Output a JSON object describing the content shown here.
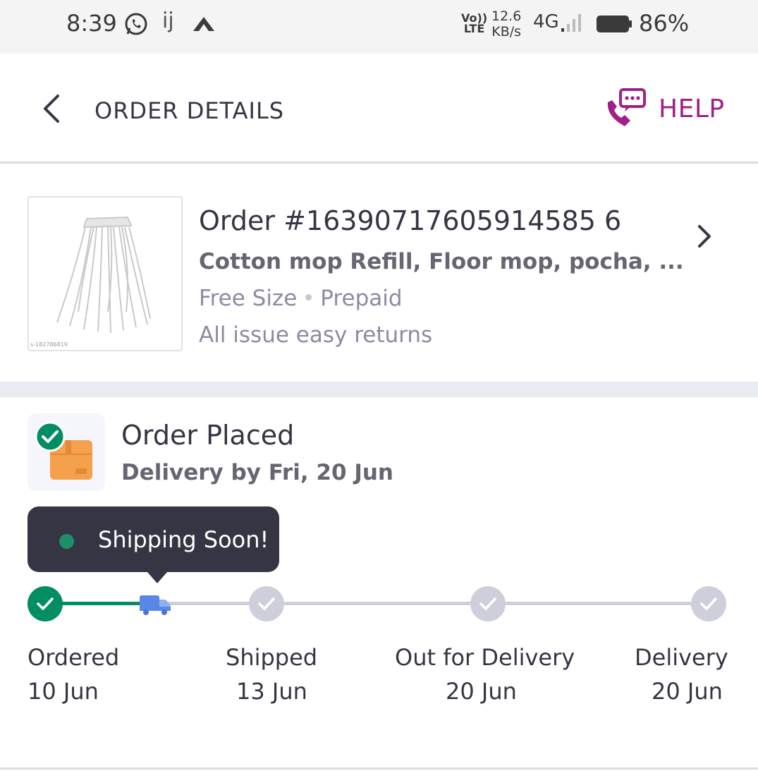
{
  "status_bar": {
    "time": "8:39",
    "app_icons": [
      "whatsapp-icon",
      "yj-icon",
      "arrow-icon"
    ],
    "yj_text": "ij",
    "volte_line1": "Vo))",
    "volte_line2": "LTE",
    "speed_value": "12.6",
    "speed_unit": "KB/s",
    "network": "4G",
    "battery": "86%"
  },
  "header": {
    "title": "ORDER DETAILS",
    "help_label": "HELP",
    "accent_color": "#9f2089"
  },
  "order": {
    "order_number": "Order #16390717605914585 6",
    "product_name": "Cotton mop Refill, Floor mop, pocha, ...",
    "size": "Free Size",
    "payment": "Prepaid",
    "returns": "All issue easy returns",
    "image_code": "s-182786819"
  },
  "status": {
    "title": "Order Placed",
    "delivery": "Delivery by  Fri, 20 Jun",
    "tooltip": "Shipping Soon!",
    "steps": [
      {
        "label": "Ordered",
        "date": "10 Jun",
        "state": "done"
      },
      {
        "label": "Shipped",
        "date": "13 Jun",
        "state": "pending"
      },
      {
        "label": "Out for Delivery",
        "date": "20 Jun",
        "state": "pending"
      },
      {
        "label": "Delivery",
        "date": "20 Jun",
        "state": "pending"
      }
    ],
    "progress_color": "#038d63",
    "pending_color": "#cfcfdc"
  }
}
